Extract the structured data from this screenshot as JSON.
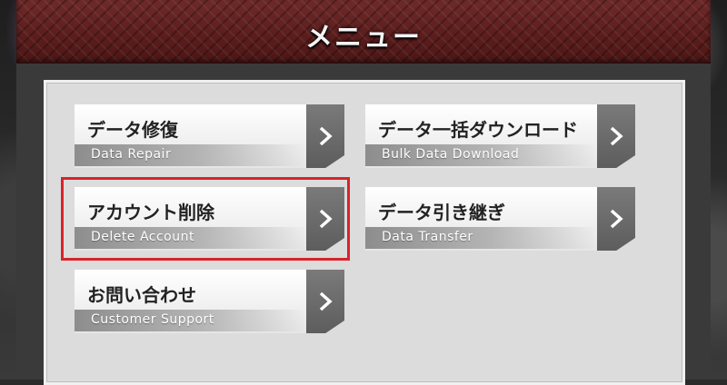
{
  "header": {
    "title": "メニュー"
  },
  "menu": {
    "items": [
      {
        "jp": "データ修復",
        "en": "Data Repair"
      },
      {
        "jp": "データ一括ダウンロード",
        "en": "Bulk Data Download"
      },
      {
        "jp": "アカウント削除",
        "en": "Delete Account",
        "highlighted": true
      },
      {
        "jp": "データ引き継ぎ",
        "en": "Data Transfer"
      },
      {
        "jp": "お問い合わせ",
        "en": "Customer Support"
      }
    ],
    "arrow_icon": "chevron-right-icon"
  },
  "colors": {
    "header_bg": "#5a1d1c",
    "panel_bg": "#dcdcdc",
    "highlight_border": "#d8232a"
  }
}
